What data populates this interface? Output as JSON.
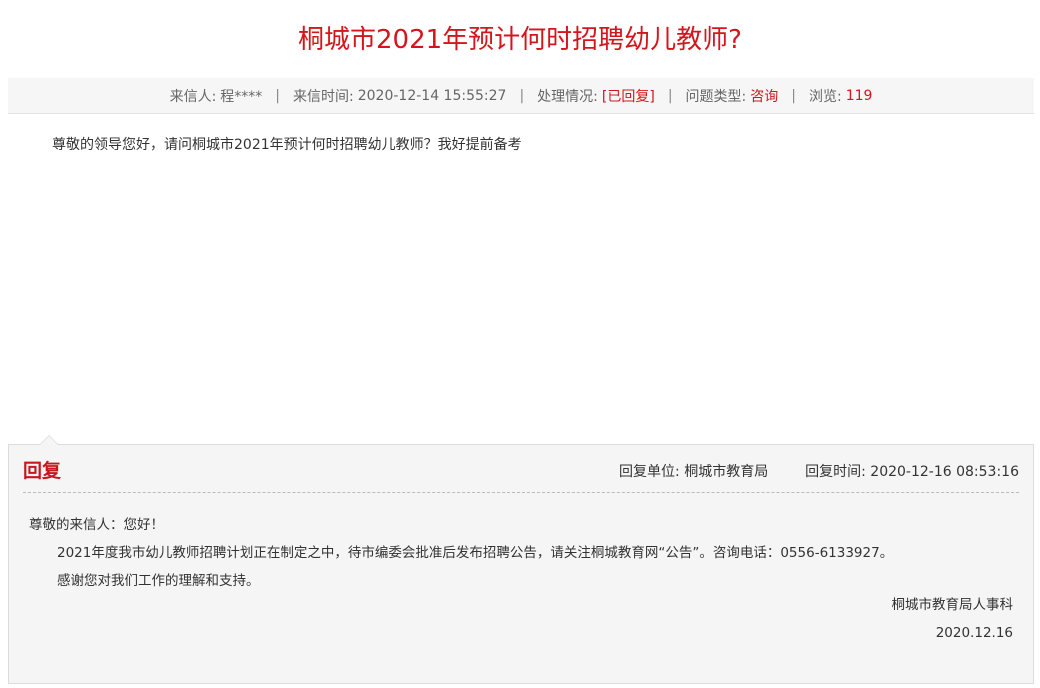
{
  "title": "桐城市2021年预计何时招聘幼儿教师?",
  "meta": {
    "sender_label": "来信人:",
    "sender_value": "程****",
    "time_label": "来信时间:",
    "time_value": "2020-12-14 15:55:27",
    "status_label": "处理情况:",
    "status_value": "[已回复]",
    "type_label": "问题类型:",
    "type_value": "咨询",
    "views_label": "浏览:",
    "views_value": "119",
    "separator": "|"
  },
  "letter": {
    "body": "尊敬的领导您好，请问桐城市2021年预计何时招聘幼儿教师？我好提前备考"
  },
  "reply": {
    "heading": "回复",
    "unit_label": "回复单位:",
    "unit_value": "桐城市教育局",
    "time_label": "回复时间:",
    "time_value": "2020-12-16 08:53:16",
    "greeting": "尊敬的来信人：您好！",
    "paragraphs": [
      "2021年度我市幼儿教师招聘计划正在制定之中，待市编委会批准后发布招聘公告，请关注桐城教育网“公告”。咨询电话：0556-6133927。",
      "感谢您对我们工作的理解和支持。"
    ],
    "signature": "桐城市教育局人事科",
    "date": "2020.12.16"
  },
  "colors": {
    "accent_red": "#d4161c",
    "reply_red": "#c8161d",
    "meta_bg": "#f6f6f6",
    "reply_bg": "#f5f5f5"
  }
}
